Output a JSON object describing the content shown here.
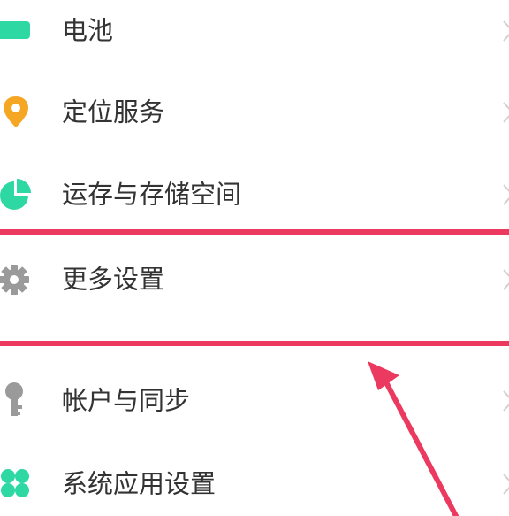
{
  "settings": {
    "items": [
      {
        "label": "电池",
        "icon": "battery-icon",
        "color": "#2dd8a3"
      },
      {
        "label": "定位服务",
        "icon": "location-pin-icon",
        "color": "#f5a623"
      },
      {
        "label": "运存与存储空间",
        "icon": "pie-chart-icon",
        "color": "#2dd8a3"
      },
      {
        "label": "更多设置",
        "icon": "gear-icon",
        "color": "#9a9a9a"
      },
      {
        "label": "帐户与同步",
        "icon": "key-icon",
        "color": "#9a9a9a"
      },
      {
        "label": "系统应用设置",
        "icon": "clover-grid-icon",
        "color": "#2dd8a3"
      }
    ]
  },
  "annotation": {
    "highlight_color": "#ec3960",
    "highlighted_item": "更多设置"
  }
}
